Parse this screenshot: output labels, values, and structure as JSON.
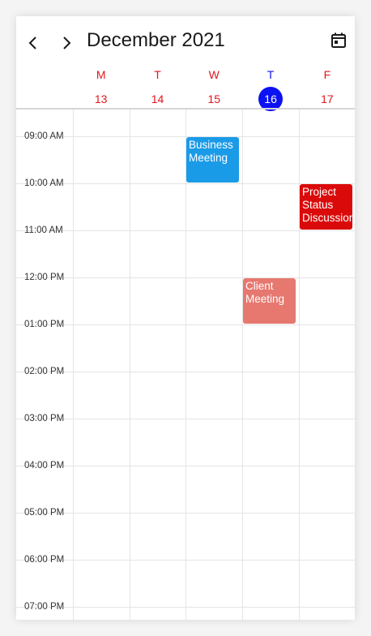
{
  "header": {
    "title": "December 2021",
    "prev_icon": "chevron-left-icon",
    "next_icon": "chevron-right-icon",
    "today_icon": "calendar-today-icon"
  },
  "colors": {
    "weekday": "#e0161d",
    "today": "#1414f0",
    "today_circle": "#0c12f2"
  },
  "days": [
    {
      "abbr": "M",
      "date": "13",
      "is_today": false
    },
    {
      "abbr": "T",
      "date": "14",
      "is_today": false
    },
    {
      "abbr": "W",
      "date": "15",
      "is_today": false
    },
    {
      "abbr": "T",
      "date": "16",
      "is_today": true
    },
    {
      "abbr": "F",
      "date": "17",
      "is_today": false
    }
  ],
  "time_slots": [
    "09:00 AM",
    "10:00 AM",
    "11:00 AM",
    "12:00 PM",
    "01:00 PM",
    "02:00 PM",
    "03:00 PM",
    "04:00 PM",
    "05:00 PM",
    "06:00 PM",
    "07:00 PM"
  ],
  "appointments": [
    {
      "subject": "Business Meeting",
      "day": 2,
      "start": "09:00",
      "end": "10:00",
      "color": "#1a9be8"
    },
    {
      "subject": "Project Status Discussion",
      "day": 4,
      "start": "10:00",
      "end": "11:00",
      "color": "#db0a0a"
    },
    {
      "subject": "Client Meeting",
      "day": 3,
      "start": "12:00",
      "end": "13:00",
      "color": "#e67870"
    }
  ]
}
